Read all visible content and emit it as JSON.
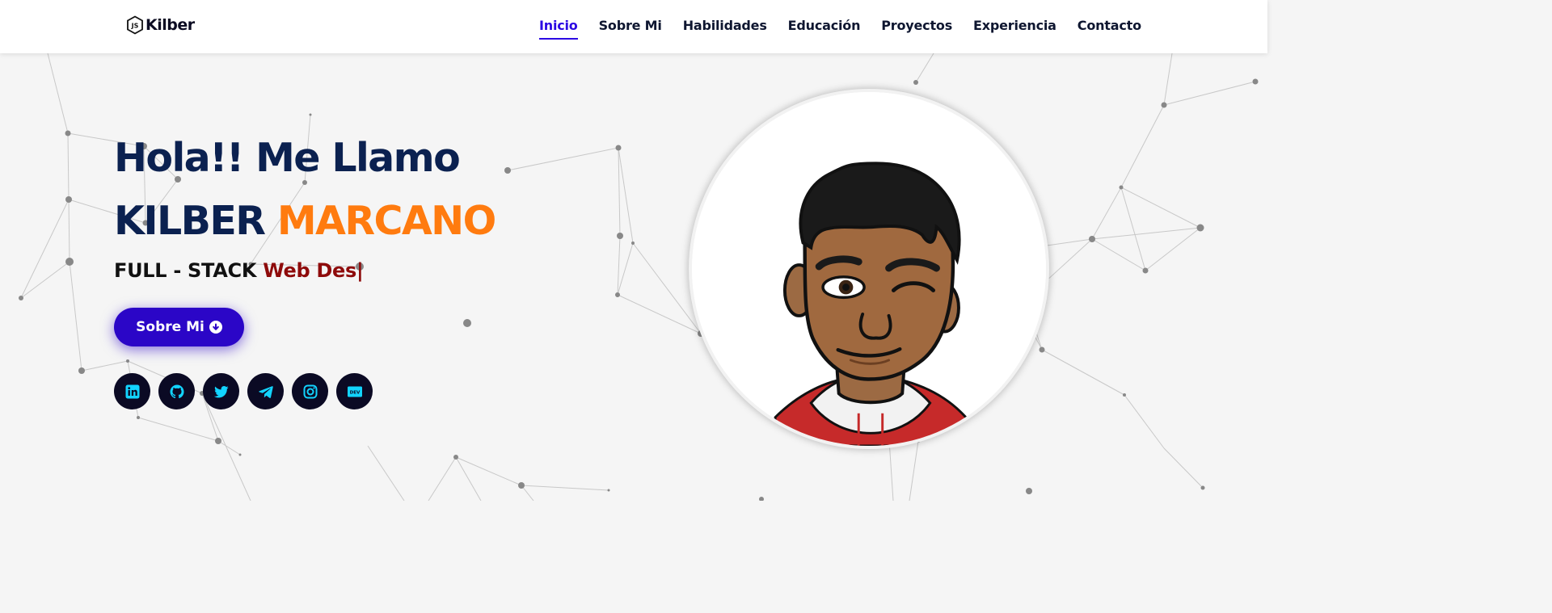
{
  "nav": {
    "logo_text": "Kilber",
    "links": [
      "Inicio",
      "Sobre Mi",
      "Habilidades",
      "Educación",
      "Proyectos",
      "Experiencia",
      "Contacto"
    ],
    "active_link": "Inicio"
  },
  "hero": {
    "greeting": "Hola!! Me Llamo",
    "first_name": "KILBER",
    "last_name": "MARCANO",
    "role_prefix": "FULL - STACK",
    "role_typed": "Web Des|",
    "button_label": "Sobre Mi"
  },
  "socials": [
    "linkedin-icon",
    "github-icon",
    "twitter-icon",
    "telegram-icon",
    "instagram-icon",
    "dev-icon"
  ],
  "colors": {
    "accent": "#2b06c7",
    "active_nav": "#2b06e3",
    "heading": "#0b2150",
    "last_name": "#ff7b0f",
    "typed_text": "#8e0b0b",
    "social_bg": "#0b0a24",
    "social_icon": "#12d4ff"
  }
}
